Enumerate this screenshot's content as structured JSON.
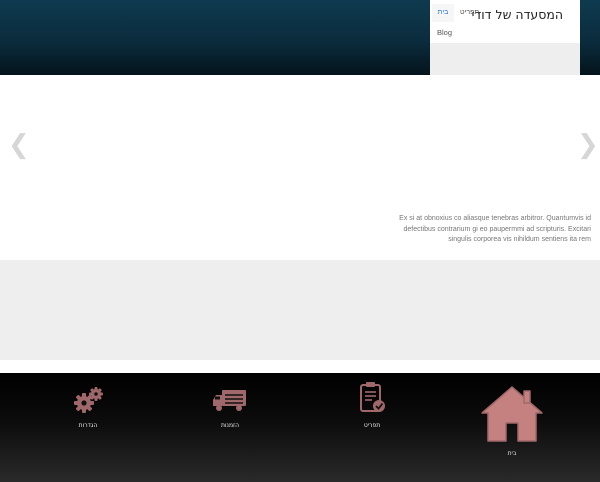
{
  "header": {
    "site_title": "המסעדה של דודי",
    "nav": {
      "home": "בית",
      "menu": "תפריט",
      "blog": "Blog"
    }
  },
  "slider": {
    "prev_icon": "chevron-left-icon",
    "next_icon": "chevron-right-icon",
    "caption": "Ex si at obnoxius co aliasque tenebras arbitror. Quantumvis id defectibus contrarium gi eo paupermmi ad scripturis. Excitari singulis corporea vis nihildum sentiens ita rem"
  },
  "dock": {
    "items": [
      {
        "label": "הגדרות",
        "icon": "gears-icon"
      },
      {
        "label": "הזמנות",
        "icon": "delivery-truck-icon"
      },
      {
        "label": "תפריט",
        "icon": "clipboard-check-icon"
      },
      {
        "label": "בית",
        "icon": "house-icon"
      }
    ]
  },
  "colors": {
    "header_top": "#0e3a4f",
    "icon_accent": "#a0686a",
    "active_tab": "#2a7bd0"
  }
}
